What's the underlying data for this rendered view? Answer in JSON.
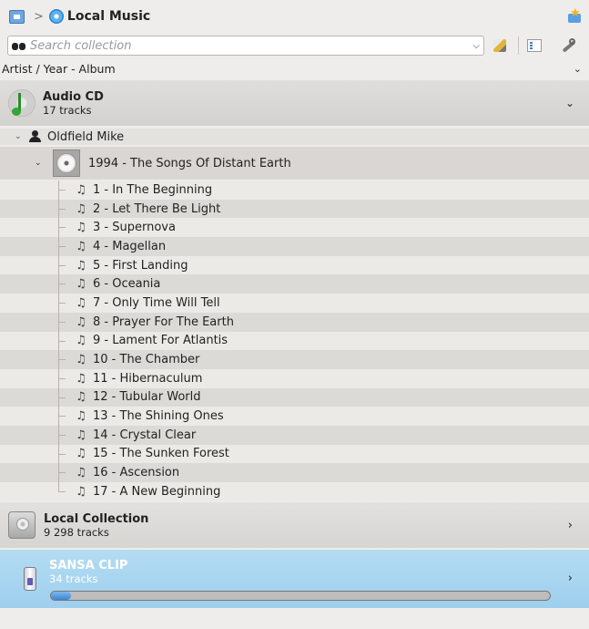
{
  "breadcrumb": {
    "home_icon": "home-icon",
    "separator": ">",
    "title": "Local Music",
    "bookmark_icon": "bookmark-star-icon"
  },
  "search": {
    "placeholder": "Search collection",
    "value": ""
  },
  "toolbar": {
    "edit_filters_icon": "edit-filters-icon",
    "view_mode_icon": "list-view-icon",
    "settings_icon": "wrench-icon"
  },
  "sort": {
    "label": "Artist / Year - Album"
  },
  "audio_cd": {
    "title": "Audio CD",
    "subtitle": "17 tracks",
    "expanded": true,
    "artist": "Oldfield Mike",
    "album": "1994 - The Songs Of Distant Earth",
    "tracks": [
      "1 - In The Beginning",
      "2 - Let There Be Light",
      "3 - Supernova",
      "4 - Magellan",
      "5 - First Landing",
      "6 - Oceania",
      "7 - Only Time Will Tell",
      "8 - Prayer For The Earth",
      "9 - Lament For Atlantis",
      "10 - The Chamber",
      "11 - Hibernaculum",
      "12 - Tubular World",
      "13 - The Shining Ones",
      "14 - Crystal Clear",
      "15 - The Sunken Forest",
      "16 - Ascension",
      "17 - A New Beginning"
    ]
  },
  "local_collection": {
    "title": "Local Collection",
    "subtitle": "9 298 tracks"
  },
  "sansa": {
    "title": "SANSA CLIP",
    "subtitle": "34 tracks",
    "capacity_used_fraction": 0.04
  },
  "colors": {
    "selected_source": "#a8d5f0",
    "progress_fill": "#3a86d6"
  }
}
